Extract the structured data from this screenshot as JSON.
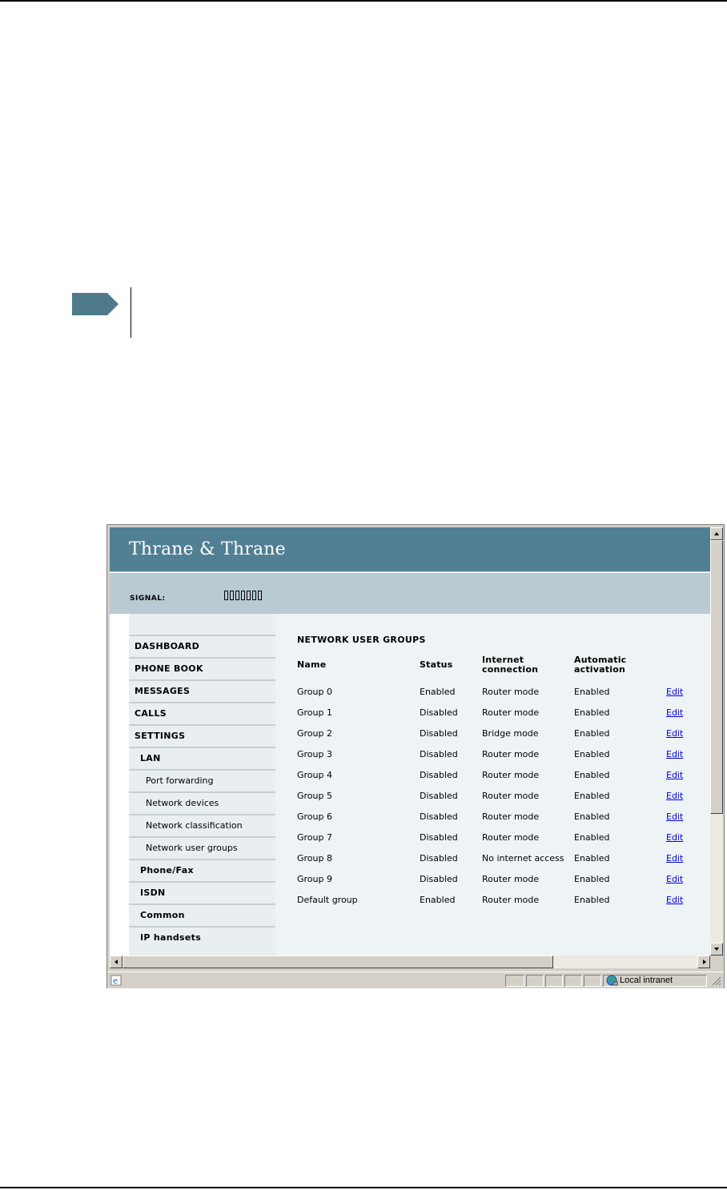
{
  "brand": {
    "name": "Thrane & Thrane"
  },
  "signal": {
    "label": "SIGNAL:",
    "bars": 7
  },
  "sidebar": {
    "items": [
      {
        "label": "DASHBOARD",
        "level": 0
      },
      {
        "label": "PHONE BOOK",
        "level": 0
      },
      {
        "label": "MESSAGES",
        "level": 0
      },
      {
        "label": "CALLS",
        "level": 0
      },
      {
        "label": "SETTINGS",
        "level": 0
      },
      {
        "label": "LAN",
        "level": 1
      },
      {
        "label": "Port forwarding",
        "level": 2
      },
      {
        "label": "Network devices",
        "level": 2
      },
      {
        "label": "Network classification",
        "level": 2
      },
      {
        "label": "Network user groups",
        "level": 2
      },
      {
        "label": "Phone/Fax",
        "level": 1
      },
      {
        "label": "ISDN",
        "level": 1
      },
      {
        "label": "Common",
        "level": 1
      },
      {
        "label": "IP handsets",
        "level": 1
      }
    ]
  },
  "main": {
    "title": "NETWORK USER GROUPS",
    "columns": {
      "name": "Name",
      "status": "Status",
      "internet_1": "Internet",
      "internet_2": "connection",
      "auto_1": "Automatic",
      "auto_2": "activation"
    },
    "rows": [
      {
        "name": "Group 0",
        "status": "Enabled",
        "internet": "Router mode",
        "activation": "Enabled",
        "action": "Edit"
      },
      {
        "name": "Group 1",
        "status": "Disabled",
        "internet": "Router mode",
        "activation": "Enabled",
        "action": "Edit"
      },
      {
        "name": "Group 2",
        "status": "Disabled",
        "internet": "Bridge mode",
        "activation": "Enabled",
        "action": "Edit"
      },
      {
        "name": "Group 3",
        "status": "Disabled",
        "internet": "Router mode",
        "activation": "Enabled",
        "action": "Edit"
      },
      {
        "name": "Group 4",
        "status": "Disabled",
        "internet": "Router mode",
        "activation": "Enabled",
        "action": "Edit"
      },
      {
        "name": "Group 5",
        "status": "Disabled",
        "internet": "Router mode",
        "activation": "Enabled",
        "action": "Edit"
      },
      {
        "name": "Group 6",
        "status": "Disabled",
        "internet": "Router mode",
        "activation": "Enabled",
        "action": "Edit"
      },
      {
        "name": "Group 7",
        "status": "Disabled",
        "internet": "Router mode",
        "activation": "Enabled",
        "action": "Edit"
      },
      {
        "name": "Group 8",
        "status": "Disabled",
        "internet": "No internet access",
        "activation": "Enabled",
        "action": "Edit"
      },
      {
        "name": "Group 9",
        "status": "Disabled",
        "internet": "Router mode",
        "activation": "Enabled",
        "action": "Edit"
      },
      {
        "name": "Default group",
        "status": "Enabled",
        "internet": "Router mode",
        "activation": "Enabled",
        "action": "Edit"
      }
    ]
  },
  "statusbar": {
    "zone": "Local intranet",
    "zone_icon": "globe-icon",
    "page_icon": "ie-page-icon"
  },
  "colors": {
    "banner": "#517f94",
    "signal_bar": "#b9cad3",
    "sidebar": "#e9eef1",
    "content": "#eef3f6",
    "link": "#0000ee",
    "note_arrow": "#4e7b8b"
  }
}
